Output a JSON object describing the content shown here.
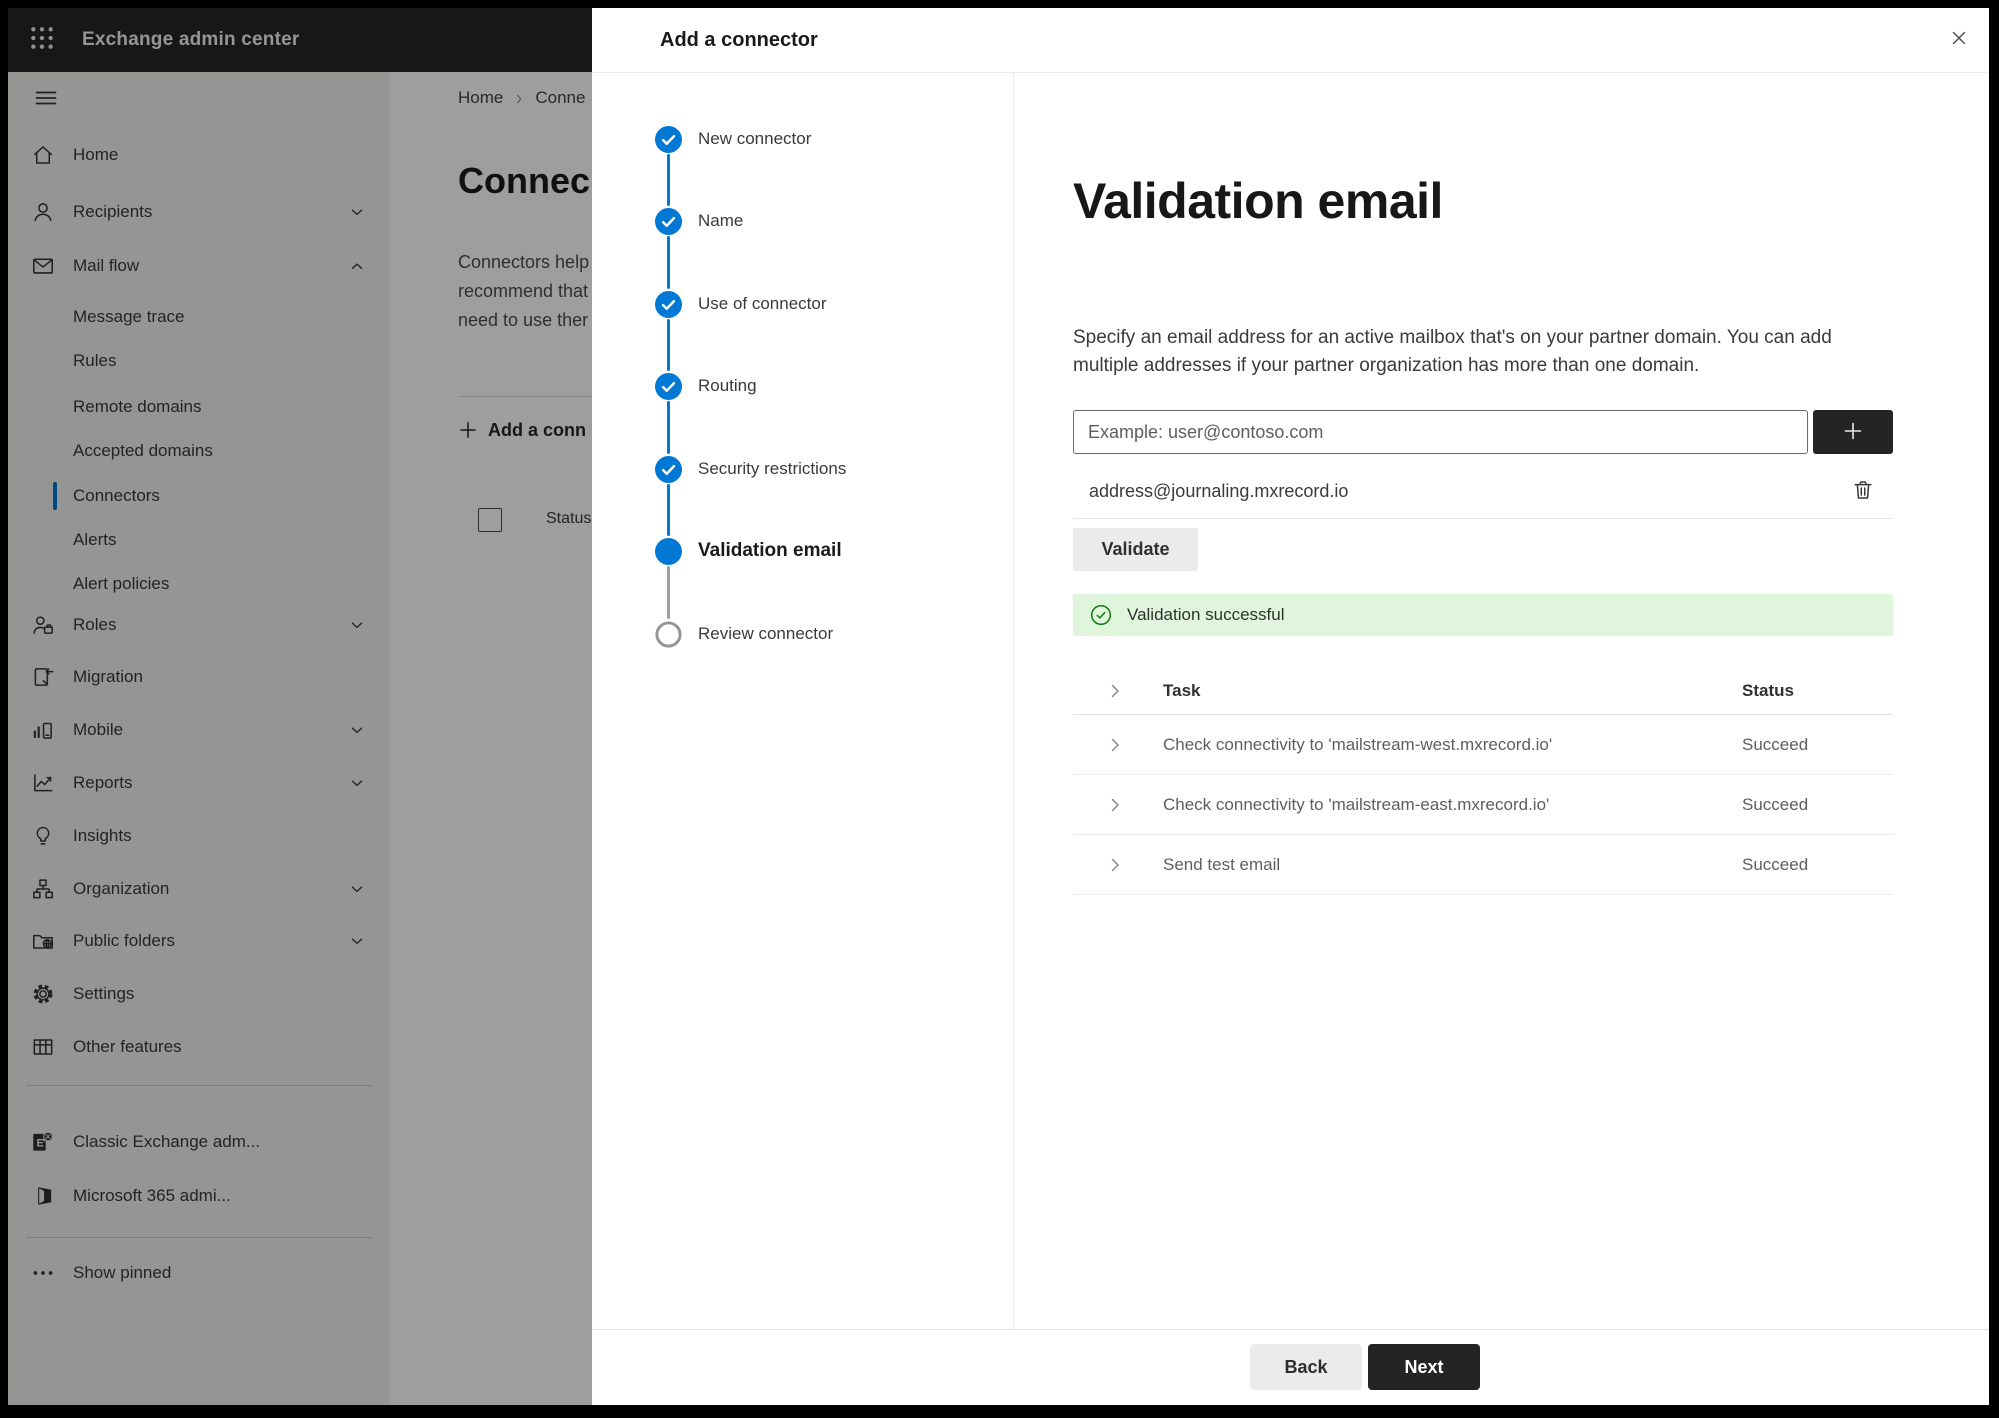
{
  "colors": {
    "accent": "#0078d4",
    "success_bg": "#dff6dd",
    "success_fg": "#107c10",
    "primary_button_bg": "#242424"
  },
  "topbar": {
    "title": "Exchange admin center"
  },
  "sidebar": {
    "items": [
      {
        "label": "Home",
        "icon": "home-icon"
      },
      {
        "label": "Recipients",
        "icon": "person-icon",
        "chevron": "down"
      },
      {
        "label": "Mail flow",
        "icon": "mail-icon",
        "chevron": "up"
      },
      {
        "label": "Message trace",
        "sub": true
      },
      {
        "label": "Rules",
        "sub": true
      },
      {
        "label": "Remote domains",
        "sub": true
      },
      {
        "label": "Accepted domains",
        "sub": true
      },
      {
        "label": "Connectors",
        "sub": true,
        "selected": true
      },
      {
        "label": "Alerts",
        "sub": true
      },
      {
        "label": "Alert policies",
        "sub": true
      },
      {
        "label": "Roles",
        "icon": "roles-icon",
        "chevron": "down"
      },
      {
        "label": "Migration",
        "icon": "migration-icon"
      },
      {
        "label": "Mobile",
        "icon": "mobile-icon",
        "chevron": "down"
      },
      {
        "label": "Reports",
        "icon": "reports-icon",
        "chevron": "down"
      },
      {
        "label": "Insights",
        "icon": "lightbulb-icon"
      },
      {
        "label": "Organization",
        "icon": "org-chart-icon",
        "chevron": "down"
      },
      {
        "label": "Public folders",
        "icon": "folder-globe-icon",
        "chevron": "down"
      },
      {
        "label": "Settings",
        "icon": "gear-icon"
      },
      {
        "label": "Other features",
        "icon": "table-icon"
      },
      {
        "label": "Classic Exchange adm...",
        "icon": "exchange-logo-icon"
      },
      {
        "label": "Microsoft 365 admi...",
        "icon": "microsoft-365-icon"
      },
      {
        "label": "Show pinned",
        "icon": "ellipsis-icon"
      }
    ]
  },
  "page": {
    "breadcrumb_home": "Home",
    "breadcrumb_current": "Conne",
    "title": "Connec",
    "intro_line1": "Connectors help",
    "intro_line2": "recommend that",
    "intro_line3": "need to use ther",
    "add_connector_label": "Add a conn",
    "list_header_status": "Status"
  },
  "dialog": {
    "title": "Add a connector",
    "steps": [
      {
        "label": "New connector",
        "state": "done"
      },
      {
        "label": "Name",
        "state": "done"
      },
      {
        "label": "Use of connector",
        "state": "done"
      },
      {
        "label": "Routing",
        "state": "done"
      },
      {
        "label": "Security restrictions",
        "state": "done"
      },
      {
        "label": "Validation email",
        "state": "current"
      },
      {
        "label": "Review connector",
        "state": "todo"
      }
    ],
    "heading": "Validation email",
    "description": "Specify an email address for an active mailbox that's on your partner domain. You can add multiple addresses if your partner organization has more than one domain.",
    "email_placeholder": "Example: user@contoso.com",
    "address": "address@journaling.mxrecord.io",
    "validate_label": "Validate",
    "banner_text": "Validation successful",
    "table": {
      "col_task": "Task",
      "col_status": "Status",
      "rows": [
        {
          "task": "Check connectivity to 'mailstream-west.mxrecord.io'",
          "status": "Succeed"
        },
        {
          "task": "Check connectivity to 'mailstream-east.mxrecord.io'",
          "status": "Succeed"
        },
        {
          "task": "Send test email",
          "status": "Succeed"
        }
      ]
    },
    "back_label": "Back",
    "next_label": "Next"
  }
}
